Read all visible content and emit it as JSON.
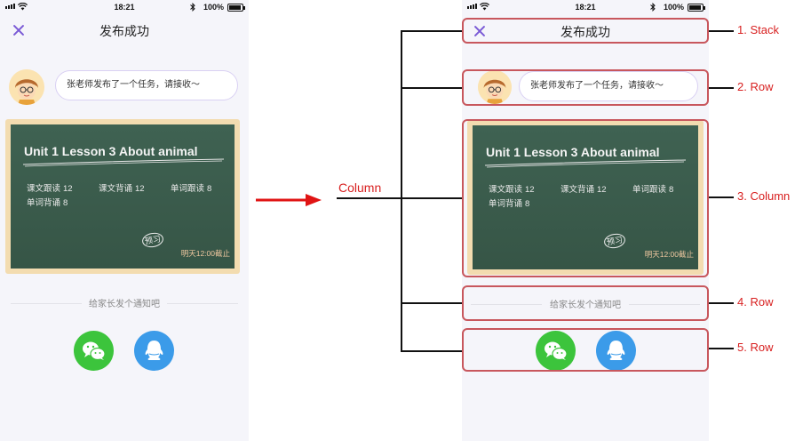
{
  "status_bar": {
    "time": "18:21",
    "battery": "100%"
  },
  "nav": {
    "title": "发布成功"
  },
  "message": {
    "text": "张老师发布了一个任务，请接收～"
  },
  "board": {
    "title": "Unit 1 Lesson 3 About animal",
    "stats": [
      {
        "label": "课文跟读",
        "count": "12"
      },
      {
        "label": "课文背诵",
        "count": "12"
      },
      {
        "label": "单词跟读",
        "count": "8"
      },
      {
        "label": "单词背诵",
        "count": "8"
      }
    ],
    "stamp": "预习",
    "deadline": "明天12:00截止"
  },
  "notify": {
    "text": "给家长发个通知吧"
  },
  "share": {
    "wechat": {
      "color": "#3cc43c",
      "icon": "wechat-icon"
    },
    "qq": {
      "color": "#3b9be9",
      "icon": "qq-icon"
    }
  },
  "diagram": {
    "column_label": "Column",
    "callouts": [
      "1. Stack",
      "2. Row",
      "3. Column",
      "4. Row",
      "5. Row"
    ],
    "highlight_color": "#c8575d",
    "callout_color": "#d82020",
    "arrow_color": "#e01414"
  }
}
